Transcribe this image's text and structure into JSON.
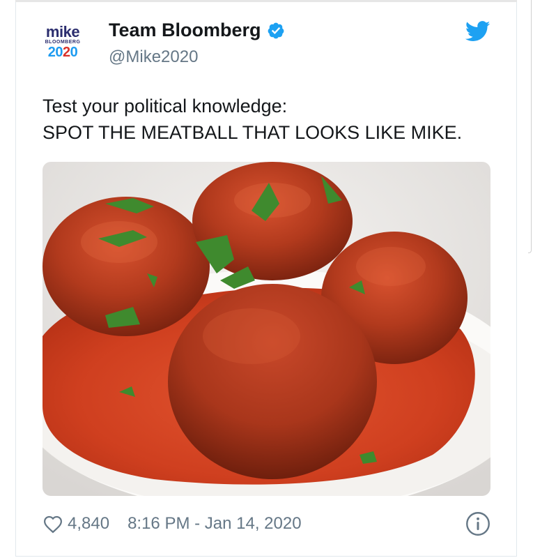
{
  "tweet": {
    "display_name": "Team Bloomberg",
    "handle": "@Mike2020",
    "text_line1": "Test your political knowledge:",
    "text_line2": "SPOT THE MEATBALL THAT LOOKS LIKE MIKE.",
    "likes": "4,840",
    "timestamp": "8:16 PM - Jan 14, 2020",
    "verified": true
  },
  "avatar": {
    "logo_line1": "mike",
    "logo_line2": "BLOOMBERG",
    "logo_year_a": "20",
    "logo_year_b": "2",
    "logo_year_c": "0"
  },
  "icons": {
    "brand": "twitter-bird-icon",
    "verified": "verified-badge-icon",
    "like": "heart-icon",
    "info": "info-icon"
  },
  "colors": {
    "twitter_blue": "#1da1f2",
    "text_primary": "#14171a",
    "text_secondary": "#657786",
    "logo_navy": "#2b2d6e",
    "logo_red": "#d9322b"
  },
  "media": {
    "subject": "meatballs-in-tomato-sauce-photo"
  }
}
